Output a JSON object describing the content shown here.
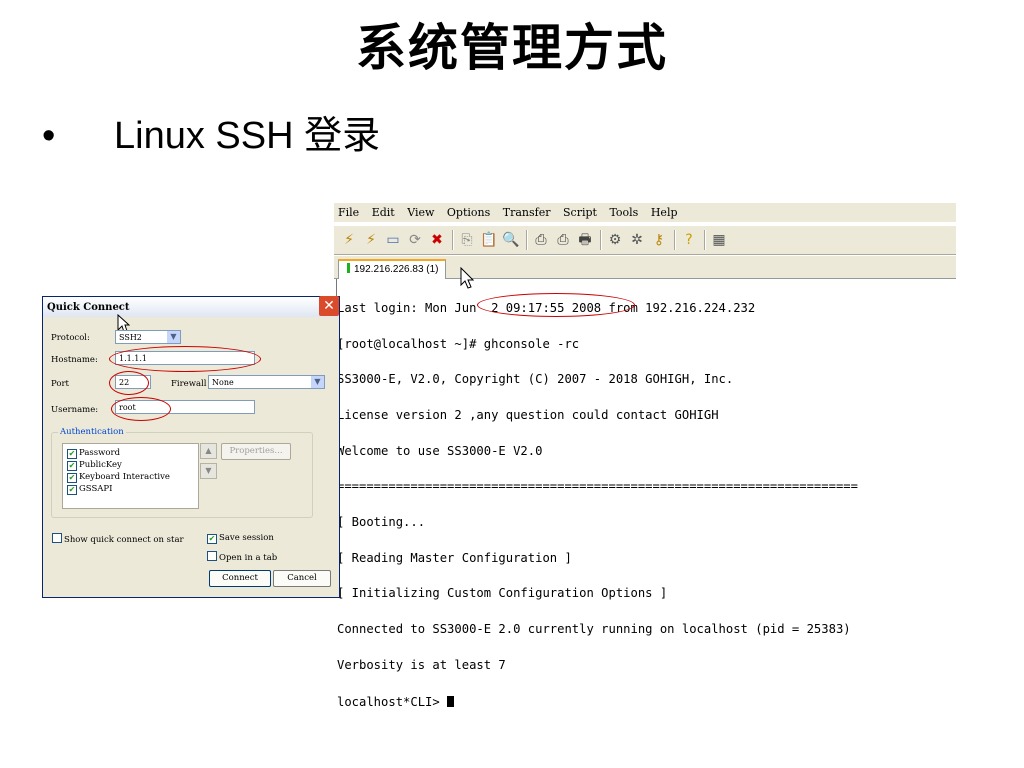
{
  "slide": {
    "title": "系统管理方式",
    "bullet_marker": "•",
    "bullet_text": "Linux SSH 登录"
  },
  "terminal": {
    "menu": [
      "File",
      "Edit",
      "View",
      "Options",
      "Transfer",
      "Script",
      "Tools",
      "Help"
    ],
    "toolbar_icons": [
      "connect-icon",
      "quick-connect-icon",
      "connect-tab-icon",
      "reconnect-icon",
      "disconnect-icon",
      "copy-icon",
      "paste-icon",
      "find-icon",
      "print-icon",
      "print-selection-icon",
      "print-setup-icon",
      "session-options-icon",
      "global-options-icon",
      "keymap-icon",
      "help-icon",
      "sftp-icon"
    ],
    "tab_label": "192.216.226.83 (1)",
    "tab_status_color": "#1db11d",
    "lines": [
      "Last login: Mon Jun  2 09:17:55 2008 from 192.216.224.232",
      "[root@localhost ~]# ghconsole -rc",
      "SS3000-E, V2.0, Copyright (C) 2007 - 2018 GOHIGH, Inc.",
      "License version 2 ,any question could contact GOHIGH",
      "Welcome to use SS3000-E V2.0",
      "=======================================================================",
      "[ Booting...",
      "[ Reading Master Configuration ]",
      "[ Initializing Custom Configuration Options ]",
      "Connected to SS3000-E 2.0 currently running on localhost (pid = 25383)",
      "Verbosity is at least 7",
      "localhost*CLI> "
    ]
  },
  "quick_connect": {
    "title": "Quick Connect",
    "protocol_label": "Protocol:",
    "protocol_value": "SSH2",
    "hostname_label": "Hostname:",
    "hostname_value": "1.1.1.1",
    "port_label": "Port",
    "port_value": "22",
    "firewall_label": "Firewall",
    "firewall_value": "None",
    "username_label": "Username:",
    "username_value": "root",
    "auth_group_title": "Authentication",
    "auth_methods": [
      {
        "label": "Password",
        "checked": true
      },
      {
        "label": "PublicKey",
        "checked": true
      },
      {
        "label": "Keyboard Interactive",
        "checked": true
      },
      {
        "label": "GSSAPI",
        "checked": true
      }
    ],
    "properties_label": "Properties...",
    "show_quick_connect_label": "Show quick connect on star",
    "show_quick_connect_checked": false,
    "save_session_label": "Save session",
    "save_session_checked": true,
    "open_in_tab_label": "Open in a tab",
    "open_in_tab_checked": false,
    "connect_label": "Connect",
    "cancel_label": "Cancel"
  },
  "colors": {
    "highlight_ellipse": "#cc0000",
    "tab_accent": "#f5a623",
    "group_title": "#0046d5",
    "dialog_bg": "#ece9d8"
  }
}
